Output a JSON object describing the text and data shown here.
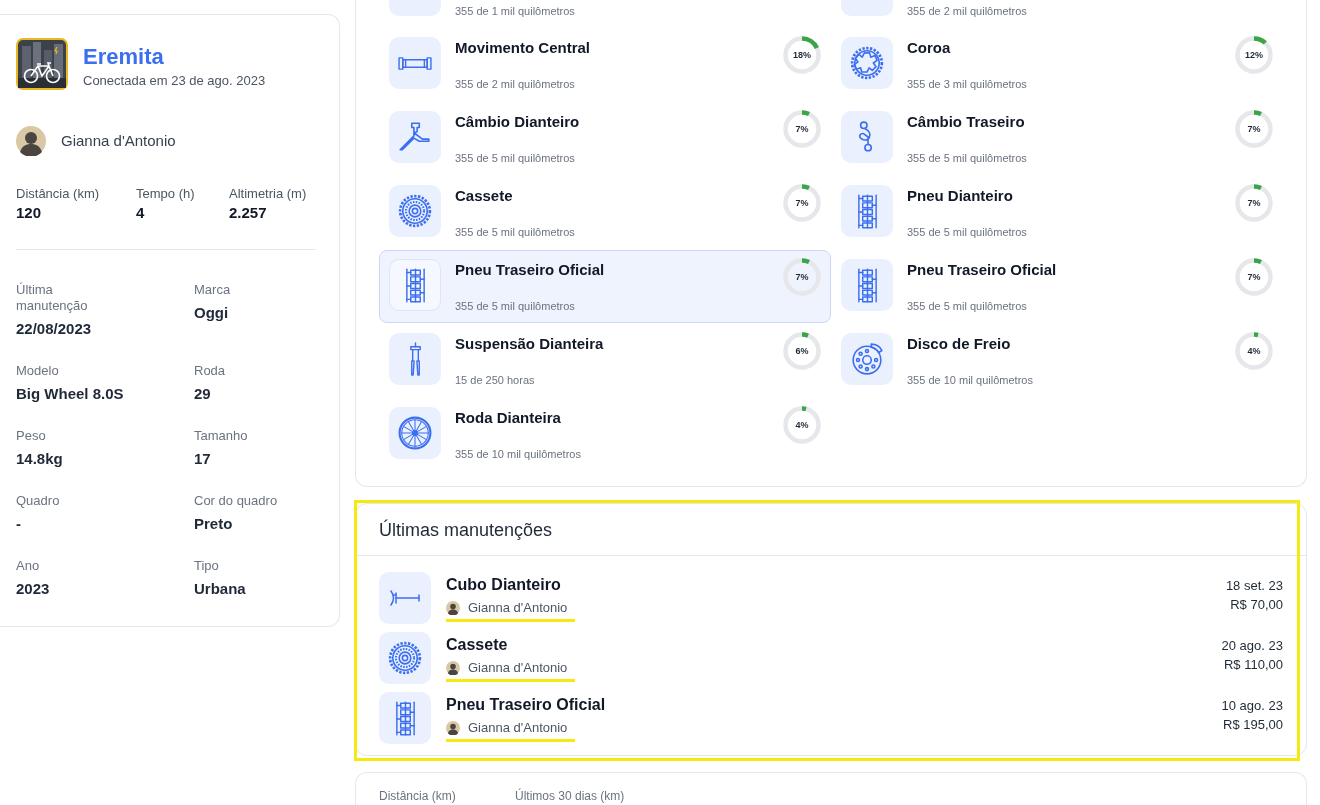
{
  "bike": {
    "name": "Eremita",
    "connected": "Conectada em 23 de ago. 2023",
    "owner": "Gianna d'Antonio",
    "stats": [
      {
        "label": "Distância (km)",
        "value": "120"
      },
      {
        "label": "Tempo (h)",
        "value": "4"
      },
      {
        "label": "Altimetria (m)",
        "value": "2.257"
      }
    ],
    "details": [
      {
        "label": "Última manutenção",
        "value": "22/08/2023"
      },
      {
        "label": "Marca",
        "value": "Oggi"
      },
      {
        "label": "Modelo",
        "value": "Big Wheel 8.0S"
      },
      {
        "label": "Roda",
        "value": "29"
      },
      {
        "label": "Peso",
        "value": "14.8kg"
      },
      {
        "label": "Tamanho",
        "value": "17"
      },
      {
        "label": "Quadro",
        "value": "-"
      },
      {
        "label": "Cor do quadro",
        "value": "Preto"
      },
      {
        "label": "Ano",
        "value": "2023"
      },
      {
        "label": "Tipo",
        "value": "Urbana"
      }
    ]
  },
  "components": {
    "cut_off_row": [
      {
        "usage": "355 de 1 mil quilômetros"
      },
      {
        "usage": "355 de 2 mil quilômetros"
      }
    ],
    "items": [
      {
        "kind": "bottom-bracket",
        "name": "Movimento Central",
        "usage": "355 de 2 mil quilômetros",
        "percent": "18%",
        "level": 0.18,
        "selected": false
      },
      {
        "kind": "chainring",
        "name": "Coroa",
        "usage": "355 de 3 mil quilômetros",
        "percent": "12%",
        "level": 0.12,
        "selected": false
      },
      {
        "kind": "front-derailleur",
        "name": "Câmbio Dianteiro",
        "usage": "355 de 5 mil quilômetros",
        "percent": "7%",
        "level": 0.07,
        "selected": false
      },
      {
        "kind": "rear-derailleur",
        "name": "Câmbio Traseiro",
        "usage": "355 de 5 mil quilômetros",
        "percent": "7%",
        "level": 0.07,
        "selected": false
      },
      {
        "kind": "cassette",
        "name": "Cassete",
        "usage": "355 de 5 mil quilômetros",
        "percent": "7%",
        "level": 0.07,
        "selected": false
      },
      {
        "kind": "tire",
        "name": "Pneu Dianteiro",
        "usage": "355 de 5 mil quilômetros",
        "percent": "7%",
        "level": 0.07,
        "selected": false
      },
      {
        "kind": "tire",
        "name": "Pneu Traseiro Oficial",
        "usage": "355 de 5 mil quilômetros",
        "percent": "7%",
        "level": 0.07,
        "selected": true
      },
      {
        "kind": "tire",
        "name": "Pneu Traseiro Oficial",
        "usage": "355 de 5 mil quilômetros",
        "percent": "7%",
        "level": 0.07,
        "selected": false
      },
      {
        "kind": "fork",
        "name": "Suspensão Dianteira",
        "usage": "15 de 250 horas",
        "percent": "6%",
        "level": 0.06,
        "selected": false
      },
      {
        "kind": "brake-disc",
        "name": "Disco de Freio",
        "usage": "355 de 10 mil quilômetros",
        "percent": "4%",
        "level": 0.04,
        "selected": false
      },
      {
        "kind": "wheel",
        "name": "Roda Dianteira",
        "usage": "355 de 10 mil quilômetros",
        "percent": "4%",
        "level": 0.04,
        "selected": false
      }
    ]
  },
  "maintenance": {
    "title": "Últimas manutenções",
    "highlighted": true,
    "entries": [
      {
        "kind": "hub",
        "part": "Cubo Dianteiro",
        "mechanic": "Gianna d'Antonio",
        "underlined": true,
        "date": "18 set. 23",
        "price": "R$ 70,00"
      },
      {
        "kind": "cassette",
        "part": "Cassete",
        "mechanic": "Gianna d'Antonio",
        "underlined": true,
        "date": "20 ago. 23",
        "price": "R$ 110,00"
      },
      {
        "kind": "tire",
        "part": "Pneu Traseiro Oficial",
        "mechanic": "Gianna d'Antonio",
        "underlined": true,
        "date": "10 ago. 23",
        "price": "R$ 195,00"
      }
    ]
  },
  "summary": {
    "labels": [
      "Distância (km)",
      "Últimos 30 dias (km)"
    ]
  }
}
